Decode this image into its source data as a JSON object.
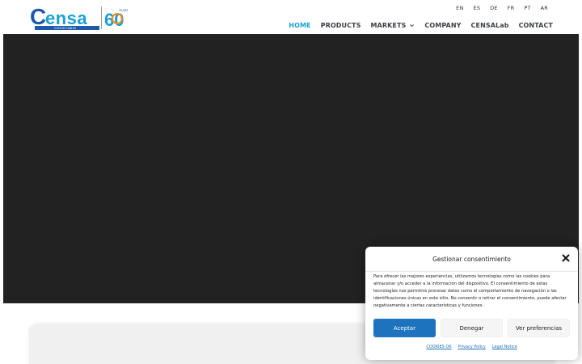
{
  "brand": {
    "name": "Censa",
    "tagline": "CUSTOM CABLES",
    "anniversary_number": "60",
    "anniversary_label": "YEARS",
    "colors": {
      "primary": "#1e5aa8",
      "accent": "#1aa0d6",
      "orange": "#f08a1e"
    }
  },
  "languages": [
    "EN",
    "ES",
    "DE",
    "FR",
    "PT",
    "AR"
  ],
  "nav": {
    "home": "HOME",
    "products": "PRODUCTS",
    "markets": "MARKETS",
    "company": "COMPANY",
    "censalab": "CENSALab",
    "contact": "CONTACT",
    "active_color": "#1aa0d6"
  },
  "cookie": {
    "title": "Gestionar consentimiento",
    "body": "Para ofrecer las mejores experiencias, utilizamos tecnologías como las cookies para almacenar y/o acceder a la información del dispositivo. El consentimiento de estas tecnologías nos permitirá procesar datos como el comportamiento de navegación o las identificaciones únicas en este sitio. No consentir o retirar el consentimiento, puede afectar negativamente a ciertas características y funciones.",
    "accept": "Aceptar",
    "deny": "Denegar",
    "preferences": "Ver preferencias",
    "links": [
      "COOKIES OK",
      "Privacy Policy",
      "Legal Notice"
    ],
    "accept_color": "#1e73be"
  }
}
